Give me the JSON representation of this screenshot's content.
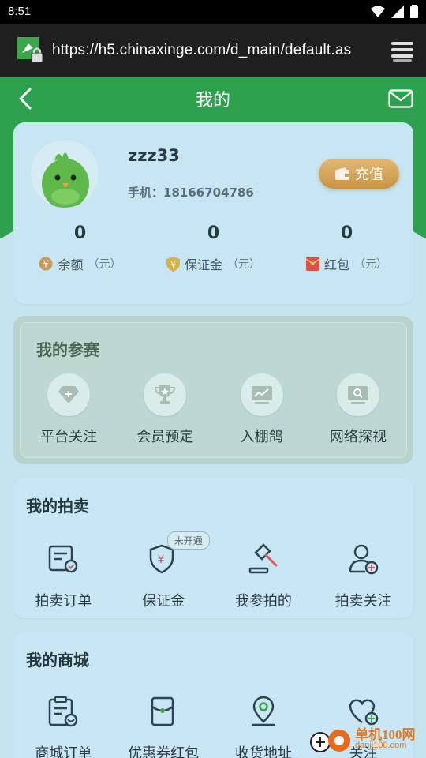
{
  "status_bar": {
    "time": "8:51"
  },
  "browser": {
    "url": "https://h5.chinaxinge.com/d_main/default.as"
  },
  "nav": {
    "title": "我的"
  },
  "profile": {
    "username": "zzz33",
    "phone_label": "手机：",
    "phone": "18166704786",
    "recharge_label": "充值",
    "stats": [
      {
        "value": "0",
        "label": "余额",
        "unit": "（元）",
        "icon": "yuan-coin-icon"
      },
      {
        "value": "0",
        "label": "保证金",
        "unit": "（元）",
        "icon": "shield-yuan-icon"
      },
      {
        "value": "0",
        "label": "红包",
        "unit": "（元）",
        "icon": "red-envelope-icon"
      }
    ]
  },
  "competition": {
    "title": "我的参赛",
    "items": [
      {
        "label": "平台关注",
        "icon": "diamond-plus-icon"
      },
      {
        "label": "会员预定",
        "icon": "trophy-icon"
      },
      {
        "label": "入棚鸽",
        "icon": "chart-icon"
      },
      {
        "label": "网络探视",
        "icon": "monitor-icon"
      }
    ]
  },
  "auction": {
    "title": "我的拍卖",
    "items": [
      {
        "label": "拍卖订单",
        "icon": "order-check-icon"
      },
      {
        "label": "保证金",
        "icon": "shield-yuan-icon",
        "badge": "未开通"
      },
      {
        "label": "我参拍的",
        "icon": "gavel-icon"
      },
      {
        "label": "拍卖关注",
        "icon": "user-plus-icon"
      }
    ]
  },
  "mall": {
    "title": "我的商城",
    "items": [
      {
        "label": "商城订单",
        "icon": "clipboard-icon"
      },
      {
        "label": "优惠券红包",
        "icon": "coupon-envelope-icon"
      },
      {
        "label": "收货地址",
        "icon": "location-pin-icon"
      },
      {
        "label": "关注",
        "icon": "heart-plus-icon"
      }
    ]
  },
  "watermark": {
    "text": "单机100网",
    "sub": "danji100.com"
  },
  "colors": {
    "header_green": "#2ea14e",
    "background": "#c6e4f0",
    "recharge_gold": "#d4a35a",
    "icon_dark": "#2d4350"
  }
}
